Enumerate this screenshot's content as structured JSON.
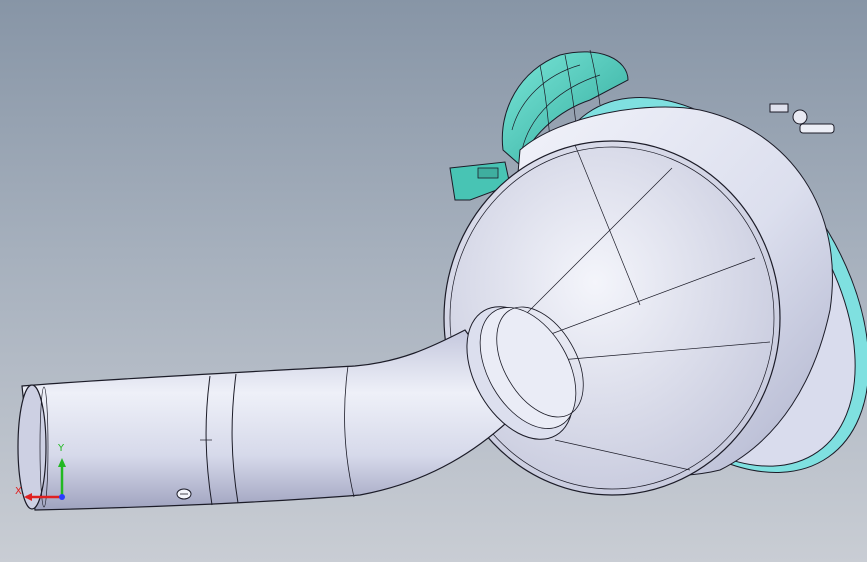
{
  "viewport": {
    "background_top": "#8795a6",
    "background_bottom": "#c9cdd4"
  },
  "model": {
    "body_color": "#dcdfee",
    "shade_color": "#b9bdd6",
    "outline_color": "#1c1c28",
    "rim_color": "#7fe0e0",
    "bracket_color": "#48c4b4"
  },
  "triad": {
    "x_label": "X",
    "y_label": "Y",
    "x_color": "#e02020",
    "y_color": "#22b822",
    "z_color": "#2a3cff"
  }
}
